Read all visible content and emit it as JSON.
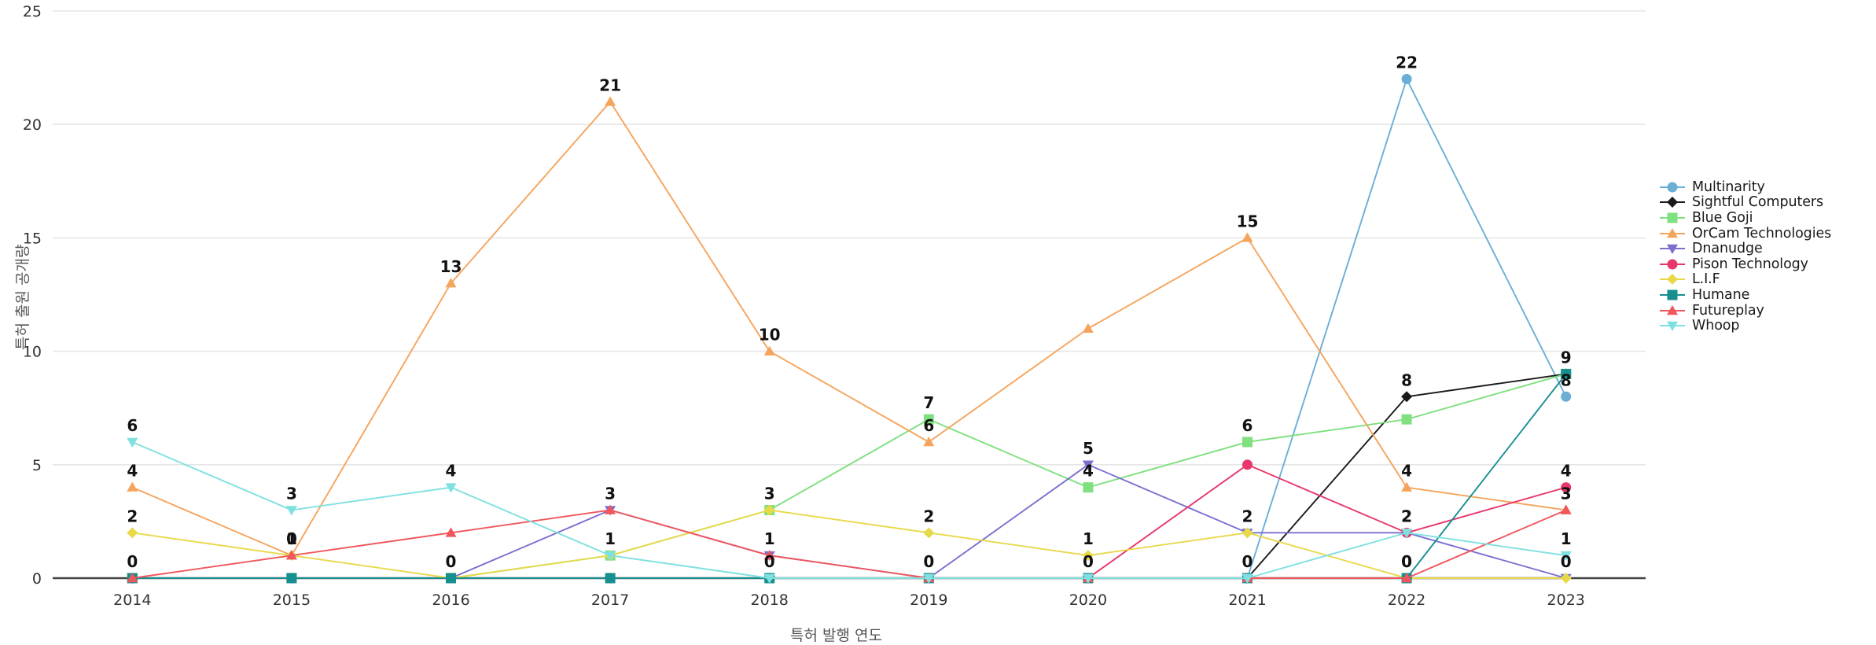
{
  "chart_data": {
    "type": "line",
    "title": "",
    "xlabel": "특허 발행 연도",
    "ylabel": "특허 출원 공개량",
    "categories": [
      "2014",
      "2015",
      "2016",
      "2017",
      "2018",
      "2019",
      "2020",
      "2021",
      "2022",
      "2023"
    ],
    "ylim": [
      0,
      25
    ],
    "yticks": [
      "0",
      "5",
      "10",
      "15",
      "20",
      "25"
    ],
    "grid": true,
    "legend_position": "right",
    "markers_shown": true,
    "data_labels_shown": true,
    "series": [
      {
        "name": "Multinarity",
        "color": "#6baed6",
        "marker": "circle",
        "values": [
          0,
          0,
          0,
          0,
          0,
          0,
          0,
          0,
          22,
          8
        ]
      },
      {
        "name": "Sightful Computers",
        "color": "#1a1a1a",
        "marker": "diamond",
        "values": [
          0,
          0,
          0,
          0,
          0,
          0,
          0,
          0,
          8,
          9
        ]
      },
      {
        "name": "Blue Goji",
        "color": "#7fe07f",
        "marker": "square",
        "values": [
          0,
          0,
          0,
          1,
          3,
          7,
          4,
          6,
          7,
          9
        ]
      },
      {
        "name": "OrCam Technologies",
        "color": "#f5a45c",
        "marker": "triangle-up",
        "values": [
          4,
          1,
          13,
          21,
          10,
          6,
          11,
          15,
          4,
          3
        ]
      },
      {
        "name": "Dnanudge",
        "color": "#7b6fd0",
        "marker": "triangle-down",
        "values": [
          0,
          0,
          0,
          3,
          1,
          0,
          5,
          2,
          2,
          0
        ]
      },
      {
        "name": "Pison Technology",
        "color": "#e8376a",
        "marker": "circle",
        "values": [
          0,
          0,
          0,
          0,
          0,
          0,
          0,
          5,
          2,
          4
        ]
      },
      {
        "name": "L.I.F",
        "color": "#e8d94a",
        "marker": "diamond",
        "values": [
          2,
          1,
          0,
          1,
          3,
          2,
          1,
          2,
          0,
          0
        ]
      },
      {
        "name": "Humane",
        "color": "#178f8f",
        "marker": "square",
        "values": [
          0,
          0,
          0,
          0,
          0,
          0,
          0,
          0,
          0,
          9
        ]
      },
      {
        "name": "Futureplay",
        "color": "#f0565c",
        "marker": "triangle-up",
        "values": [
          0,
          1,
          2,
          3,
          1,
          0,
          0,
          0,
          0,
          3
        ]
      },
      {
        "name": "Whoop",
        "color": "#7fe0e0",
        "marker": "triangle-down",
        "values": [
          6,
          3,
          4,
          1,
          0,
          0,
          0,
          0,
          2,
          1
        ]
      }
    ],
    "point_labels": [
      {
        "series": "Whoop",
        "x": "2014",
        "text": "6"
      },
      {
        "series": "OrCam Technologies",
        "x": "2014",
        "text": "4"
      },
      {
        "series": "L.I.F",
        "x": "2014",
        "text": "2"
      },
      {
        "series": "Humane",
        "x": "2014",
        "text": "0"
      },
      {
        "series": "Whoop",
        "x": "2015",
        "text": "3"
      },
      {
        "series": "L.I.F",
        "x": "2015",
        "text": "1"
      },
      {
        "series": "Futureplay",
        "x": "2015",
        "text": "0"
      },
      {
        "series": "OrCam Technologies",
        "x": "2016",
        "text": "13"
      },
      {
        "series": "Whoop",
        "x": "2016",
        "text": "4"
      },
      {
        "series": "Blue Goji",
        "x": "2016",
        "text": "0"
      },
      {
        "series": "OrCam Technologies",
        "x": "2017",
        "text": "21"
      },
      {
        "series": "Dnanudge",
        "x": "2017",
        "text": "3"
      },
      {
        "series": "Whoop",
        "x": "2017",
        "text": "1"
      },
      {
        "series": "OrCam Technologies",
        "x": "2018",
        "text": "10"
      },
      {
        "series": "Blue Goji",
        "x": "2018",
        "text": "3"
      },
      {
        "series": "Futureplay",
        "x": "2018",
        "text": "1"
      },
      {
        "series": "Whoop",
        "x": "2018",
        "text": "0"
      },
      {
        "series": "Blue Goji",
        "x": "2019",
        "text": "7"
      },
      {
        "series": "OrCam Technologies",
        "x": "2019",
        "text": "6"
      },
      {
        "series": "L.I.F",
        "x": "2019",
        "text": "2"
      },
      {
        "series": "Whoop",
        "x": "2019",
        "text": "0"
      },
      {
        "series": "Dnanudge",
        "x": "2020",
        "text": "5"
      },
      {
        "series": "Blue Goji",
        "x": "2020",
        "text": "4"
      },
      {
        "series": "L.I.F",
        "x": "2020",
        "text": "1"
      },
      {
        "series": "Whoop",
        "x": "2020",
        "text": "0"
      },
      {
        "series": "OrCam Technologies",
        "x": "2021",
        "text": "15"
      },
      {
        "series": "Blue Goji",
        "x": "2021",
        "text": "6"
      },
      {
        "series": "L.I.F",
        "x": "2021",
        "text": "2"
      },
      {
        "series": "Whoop",
        "x": "2021",
        "text": "0"
      },
      {
        "series": "Multinarity",
        "x": "2022",
        "text": "22"
      },
      {
        "series": "Sightful Computers",
        "x": "2022",
        "text": "8"
      },
      {
        "series": "OrCam Technologies",
        "x": "2022",
        "text": "4"
      },
      {
        "series": "Dnanudge",
        "x": "2022",
        "text": "2"
      },
      {
        "series": "Whoop",
        "x": "2022",
        "text": "2"
      },
      {
        "series": "L.I.F",
        "x": "2022",
        "text": "0"
      },
      {
        "series": "Humane",
        "x": "2022",
        "text": "0"
      },
      {
        "series": "Humane",
        "x": "2023",
        "text": "9"
      },
      {
        "series": "Multinarity",
        "x": "2023",
        "text": "8"
      },
      {
        "series": "Pison Technology",
        "x": "2023",
        "text": "4"
      },
      {
        "series": "Futureplay",
        "x": "2023",
        "text": "3"
      },
      {
        "series": "Whoop",
        "x": "2023",
        "text": "1"
      },
      {
        "series": "Dnanudge",
        "x": "2023",
        "text": "0"
      }
    ]
  }
}
